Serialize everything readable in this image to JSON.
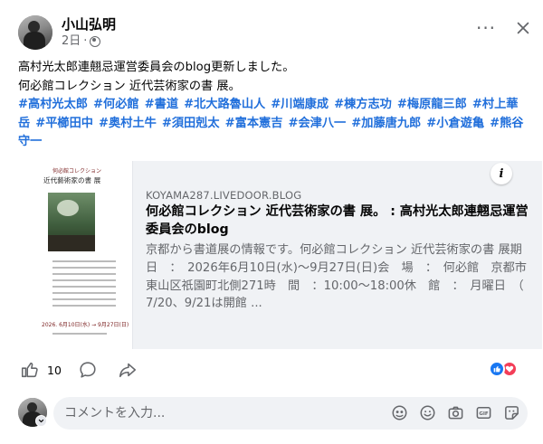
{
  "post": {
    "author": "小山弘明",
    "time": "2日",
    "separator": "·",
    "text_lines": [
      "高村光太郎連翹忌運営委員会のblog更新しました。",
      "何必館コレクション 近代芸術家の書 展。"
    ],
    "hashtags": [
      "#高村光太郎",
      "#何必館",
      "#書道",
      "#北大路魯山人",
      "#川端康成",
      "#棟方志功",
      "#梅原龍三郎",
      "#村上華岳",
      "#平櫛田中",
      "#奥村土牛",
      "#須田剋太",
      "#富本憲吉",
      "#会津八一",
      "#加藤唐九郎",
      "#小倉遊亀",
      "#熊谷守一"
    ]
  },
  "preview": {
    "domain": "KOYAMA287.LIVEDOOR.BLOG",
    "title": "何必館コレクション 近代芸術家の書 展。 : 高村光太郎連翹忌運営委員会のblog",
    "description": "京都から書道展の情報です。何必館コレクション 近代芸術家の書 展期　日　：　2026年6月10日(水)～9月27日(日)会　場　：　何必館　京都市東山区祇園町北側271時　間　：10:00～18:00休　館　：　月曜日　（ 7/20、9/21は開館 ...",
    "info_label": "i",
    "thumb_small": "何必館コレクション",
    "thumb_title": "近代藝術家の書 展",
    "thumb_dates": "2026. 6月10日(水) → 9月27日(日)"
  },
  "actions": {
    "like_count": "10",
    "more_glyph": "···"
  },
  "comment": {
    "placeholder": "コメントを入力..."
  },
  "colors": {
    "hashtag": "#216fdb",
    "like_blue": "#1877f2",
    "love_red": "#f33e58",
    "secondary_text": "#65676b",
    "preview_bg": "#f0f2f5"
  },
  "icons": {
    "more": "more-horizontal-icon",
    "close": "close-icon",
    "privacy": "globe-icon",
    "like": "thumbs-up-icon",
    "comment": "comment-bubble-icon",
    "share": "share-arrow-icon",
    "reaction_like": "like-reaction-icon",
    "reaction_love": "love-reaction-icon",
    "avatar_sticker": "sticker-icon",
    "emoji": "emoji-icon",
    "camera": "camera-icon",
    "gif": "gif-icon",
    "sticker": "sticker-icon"
  }
}
